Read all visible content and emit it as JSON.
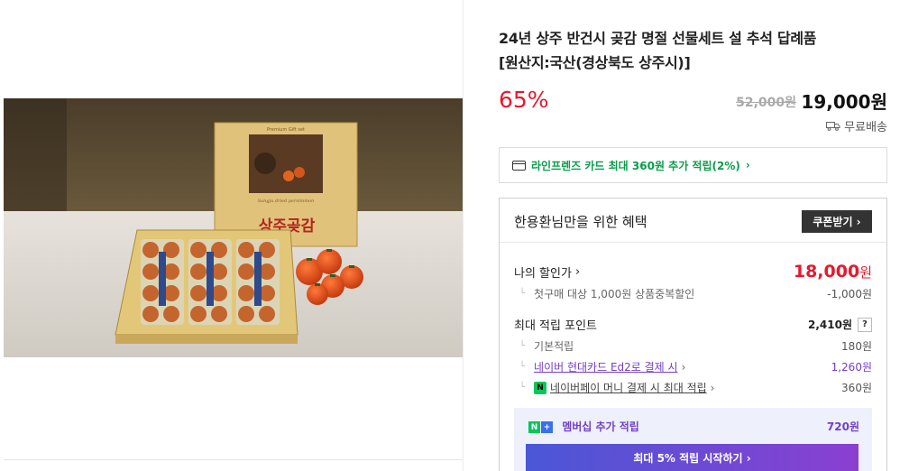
{
  "product": {
    "title_line1": "24년 상주 반건시 곶감 명절 선물세트 설 추석 답례품",
    "title_line2": "[원산지:국산(경상북도 상주시)]",
    "discount": "65%",
    "original_price": "52,000원",
    "sale_price": "19,000원",
    "shipping": "무료배송",
    "photo": {
      "box_label": "Premium Gift set",
      "box_brand": "상주곶감",
      "box_subtitle": "Sangju dried persimmon"
    }
  },
  "card_promo": {
    "text": "라인프렌즈 카드 최대 360원 추가 적립(2%)",
    "arrow": "›"
  },
  "benefit": {
    "title": "한용환님만을 위한 혜택",
    "coupon_button": "쿠폰받기 ›",
    "my_price_label": "나의 할인가",
    "my_price_number": "18,000",
    "my_price_unit": "원",
    "first_purchase_label": "첫구매 대상 1,000원 상품중복할인",
    "first_purchase_value": "-1,000원",
    "max_point_label": "최대 적립 포인트",
    "max_point_value": "2,410원",
    "help": "?",
    "basic_label": "기본적립",
    "basic_value": "180원",
    "hyundai_label": "네이버 현대카드 Ed2로 결제 시",
    "hyundai_value": "1,260원",
    "npay_label": "네이버페이 머니 결제 시 최대 적립",
    "npay_value": "360원",
    "arrow": "›",
    "tick": "└"
  },
  "membership": {
    "label": "멤버십 추가 적립",
    "value": "720원",
    "button": "최대 5% 적립 시작하기 ›",
    "badge_n": "N",
    "badge_plus": "+"
  },
  "colors": {
    "discount_red": "#e6192d",
    "green": "#0a9d4b",
    "purple": "#7240c8",
    "membership_bg": "#eef0fb"
  }
}
